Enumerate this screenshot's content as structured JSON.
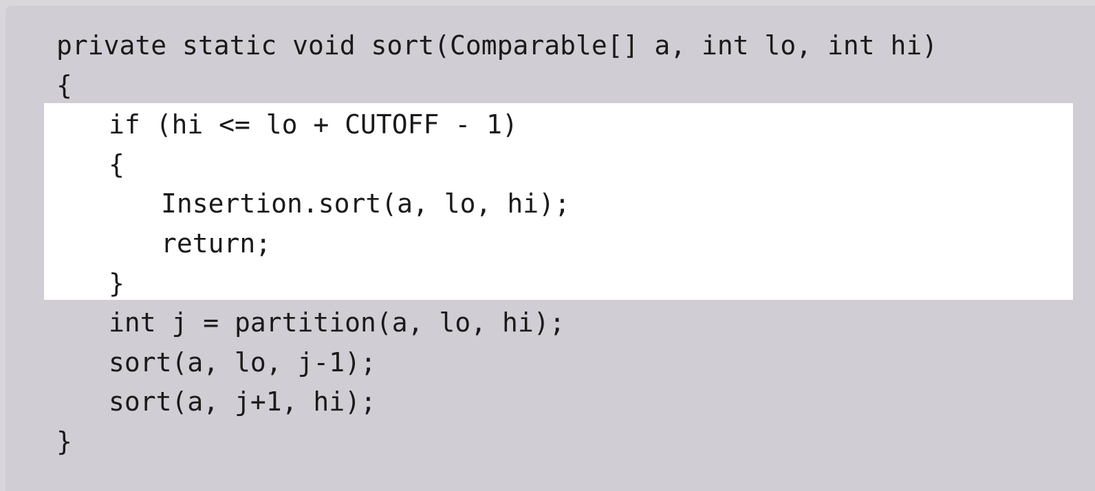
{
  "code": {
    "lines": [
      "private static void sort(Comparable[] a, int lo, int hi)",
      "{",
      "if (hi <= lo + CUTOFF - 1)",
      "{",
      "Insertion.sort(a, lo, hi);",
      "return;",
      "}",
      "int j = partition(a, lo, hi);",
      "sort(a, lo, j-1);",
      "sort(a, j+1, hi);",
      "}"
    ],
    "highlighted_lines": [
      2,
      3,
      4,
      5,
      6
    ]
  },
  "colors": {
    "panel_background": "#d0cdd4",
    "highlight": "#ffffff",
    "text": "#1a1a1a"
  }
}
